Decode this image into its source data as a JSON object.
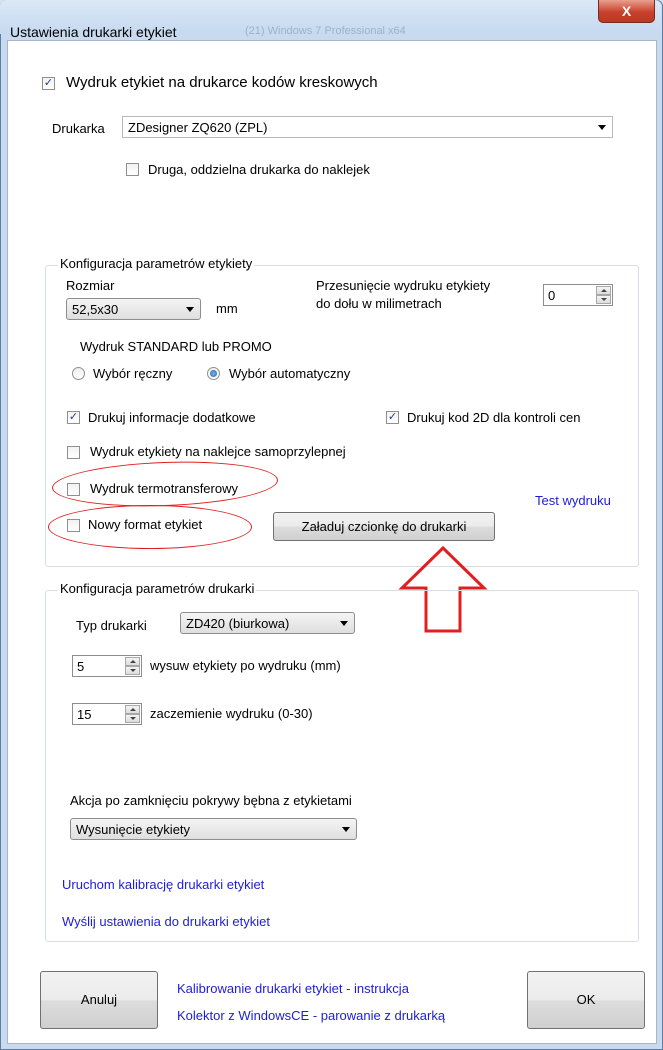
{
  "window": {
    "title": "Ustawienia drukarki etykiet",
    "title_ghost": "(21) Windows 7 Professional x64",
    "close_glyph": "X"
  },
  "barcode_print": {
    "label": "Wydruk etykiet na drukarce kodów kreskowych",
    "checked": true,
    "printer_label": "Drukarka",
    "printer_value": "ZDesigner ZQ620 (ZPL)",
    "second_printer_label": "Druga, oddzielna drukarka do naklejek",
    "second_printer_checked": false
  },
  "label_config": {
    "group_title": "Konfiguracja parametrów etykiety",
    "size_label": "Rozmiar",
    "size_value": "52,5x30",
    "size_unit": "mm",
    "offset_label_line1": "Przesunięcie wydruku etykiety",
    "offset_label_line2": "do dołu w milimetrach",
    "offset_value": "0",
    "mode_title": "Wydruk STANDARD lub PROMO",
    "radio_manual": "Wybór ręczny",
    "radio_auto": "Wybór automatyczny",
    "selected_mode": "auto",
    "extra_info": "Drukuj informacje dodatkowe",
    "extra_info_checked": true,
    "code2d": "Drukuj kod 2D dla kontroli cen",
    "code2d_checked": true,
    "sticker": "Wydruk etykiety na naklejce samoprzylepnej",
    "thermo": "Wydruk termotransferowy",
    "new_format": "Nowy format etykiet",
    "load_font_button": "Załaduj czcionkę do drukarki",
    "test_print": "Test wydruku"
  },
  "printer_config": {
    "group_title": "Konfiguracja parametrów drukarki",
    "type_label": "Typ drukarki",
    "type_value": "ZD420 (biurkowa)",
    "feed_value": "5",
    "feed_label": "wysuw etykiety po wydruku (mm)",
    "darkness_value": "15",
    "darkness_label": "zaczemienie wydruku (0-30)",
    "action_label": "Akcja po zamknięciu pokrywy bębna z etykietami",
    "action_value": "Wysunięcie etykiety",
    "calibrate_link": "Uruchom kalibrację drukarki etykiet",
    "send_link": "Wyślij ustawienia do drukarki etykiet"
  },
  "footer": {
    "cancel": "Anuluj",
    "ok": "OK",
    "link1": "Kalibrowanie drukarki etykiet - instrukcja",
    "link2": "Kolektor z WindowsCE - parowanie z drukarką"
  },
  "colors": {
    "annotation": "#e02020",
    "link": "#1d1dd6"
  }
}
